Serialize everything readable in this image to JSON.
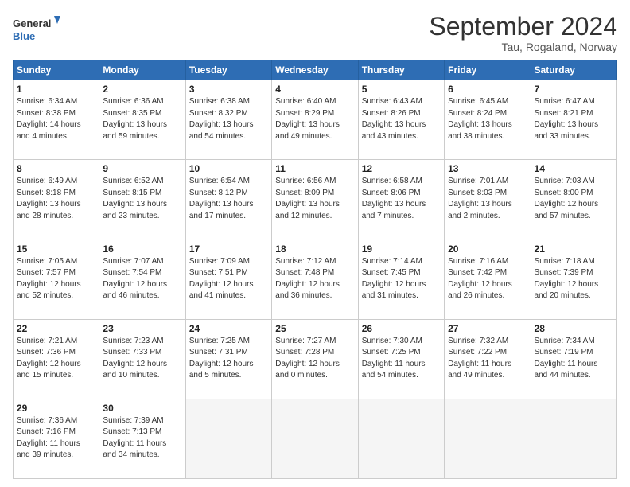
{
  "logo": {
    "line1": "General",
    "line2": "Blue"
  },
  "title": "September 2024",
  "subtitle": "Tau, Rogaland, Norway",
  "headers": [
    "Sunday",
    "Monday",
    "Tuesday",
    "Wednesday",
    "Thursday",
    "Friday",
    "Saturday"
  ],
  "weeks": [
    [
      {
        "day": "1",
        "info": "Sunrise: 6:34 AM\nSunset: 8:38 PM\nDaylight: 14 hours\nand 4 minutes."
      },
      {
        "day": "2",
        "info": "Sunrise: 6:36 AM\nSunset: 8:35 PM\nDaylight: 13 hours\nand 59 minutes."
      },
      {
        "day": "3",
        "info": "Sunrise: 6:38 AM\nSunset: 8:32 PM\nDaylight: 13 hours\nand 54 minutes."
      },
      {
        "day": "4",
        "info": "Sunrise: 6:40 AM\nSunset: 8:29 PM\nDaylight: 13 hours\nand 49 minutes."
      },
      {
        "day": "5",
        "info": "Sunrise: 6:43 AM\nSunset: 8:26 PM\nDaylight: 13 hours\nand 43 minutes."
      },
      {
        "day": "6",
        "info": "Sunrise: 6:45 AM\nSunset: 8:24 PM\nDaylight: 13 hours\nand 38 minutes."
      },
      {
        "day": "7",
        "info": "Sunrise: 6:47 AM\nSunset: 8:21 PM\nDaylight: 13 hours\nand 33 minutes."
      }
    ],
    [
      {
        "day": "8",
        "info": "Sunrise: 6:49 AM\nSunset: 8:18 PM\nDaylight: 13 hours\nand 28 minutes."
      },
      {
        "day": "9",
        "info": "Sunrise: 6:52 AM\nSunset: 8:15 PM\nDaylight: 13 hours\nand 23 minutes."
      },
      {
        "day": "10",
        "info": "Sunrise: 6:54 AM\nSunset: 8:12 PM\nDaylight: 13 hours\nand 17 minutes."
      },
      {
        "day": "11",
        "info": "Sunrise: 6:56 AM\nSunset: 8:09 PM\nDaylight: 13 hours\nand 12 minutes."
      },
      {
        "day": "12",
        "info": "Sunrise: 6:58 AM\nSunset: 8:06 PM\nDaylight: 13 hours\nand 7 minutes."
      },
      {
        "day": "13",
        "info": "Sunrise: 7:01 AM\nSunset: 8:03 PM\nDaylight: 13 hours\nand 2 minutes."
      },
      {
        "day": "14",
        "info": "Sunrise: 7:03 AM\nSunset: 8:00 PM\nDaylight: 12 hours\nand 57 minutes."
      }
    ],
    [
      {
        "day": "15",
        "info": "Sunrise: 7:05 AM\nSunset: 7:57 PM\nDaylight: 12 hours\nand 52 minutes."
      },
      {
        "day": "16",
        "info": "Sunrise: 7:07 AM\nSunset: 7:54 PM\nDaylight: 12 hours\nand 46 minutes."
      },
      {
        "day": "17",
        "info": "Sunrise: 7:09 AM\nSunset: 7:51 PM\nDaylight: 12 hours\nand 41 minutes."
      },
      {
        "day": "18",
        "info": "Sunrise: 7:12 AM\nSunset: 7:48 PM\nDaylight: 12 hours\nand 36 minutes."
      },
      {
        "day": "19",
        "info": "Sunrise: 7:14 AM\nSunset: 7:45 PM\nDaylight: 12 hours\nand 31 minutes."
      },
      {
        "day": "20",
        "info": "Sunrise: 7:16 AM\nSunset: 7:42 PM\nDaylight: 12 hours\nand 26 minutes."
      },
      {
        "day": "21",
        "info": "Sunrise: 7:18 AM\nSunset: 7:39 PM\nDaylight: 12 hours\nand 20 minutes."
      }
    ],
    [
      {
        "day": "22",
        "info": "Sunrise: 7:21 AM\nSunset: 7:36 PM\nDaylight: 12 hours\nand 15 minutes."
      },
      {
        "day": "23",
        "info": "Sunrise: 7:23 AM\nSunset: 7:33 PM\nDaylight: 12 hours\nand 10 minutes."
      },
      {
        "day": "24",
        "info": "Sunrise: 7:25 AM\nSunset: 7:31 PM\nDaylight: 12 hours\nand 5 minutes."
      },
      {
        "day": "25",
        "info": "Sunrise: 7:27 AM\nSunset: 7:28 PM\nDaylight: 12 hours\nand 0 minutes."
      },
      {
        "day": "26",
        "info": "Sunrise: 7:30 AM\nSunset: 7:25 PM\nDaylight: 11 hours\nand 54 minutes."
      },
      {
        "day": "27",
        "info": "Sunrise: 7:32 AM\nSunset: 7:22 PM\nDaylight: 11 hours\nand 49 minutes."
      },
      {
        "day": "28",
        "info": "Sunrise: 7:34 AM\nSunset: 7:19 PM\nDaylight: 11 hours\nand 44 minutes."
      }
    ],
    [
      {
        "day": "29",
        "info": "Sunrise: 7:36 AM\nSunset: 7:16 PM\nDaylight: 11 hours\nand 39 minutes."
      },
      {
        "day": "30",
        "info": "Sunrise: 7:39 AM\nSunset: 7:13 PM\nDaylight: 11 hours\nand 34 minutes."
      },
      {
        "day": "",
        "info": ""
      },
      {
        "day": "",
        "info": ""
      },
      {
        "day": "",
        "info": ""
      },
      {
        "day": "",
        "info": ""
      },
      {
        "day": "",
        "info": ""
      }
    ]
  ]
}
